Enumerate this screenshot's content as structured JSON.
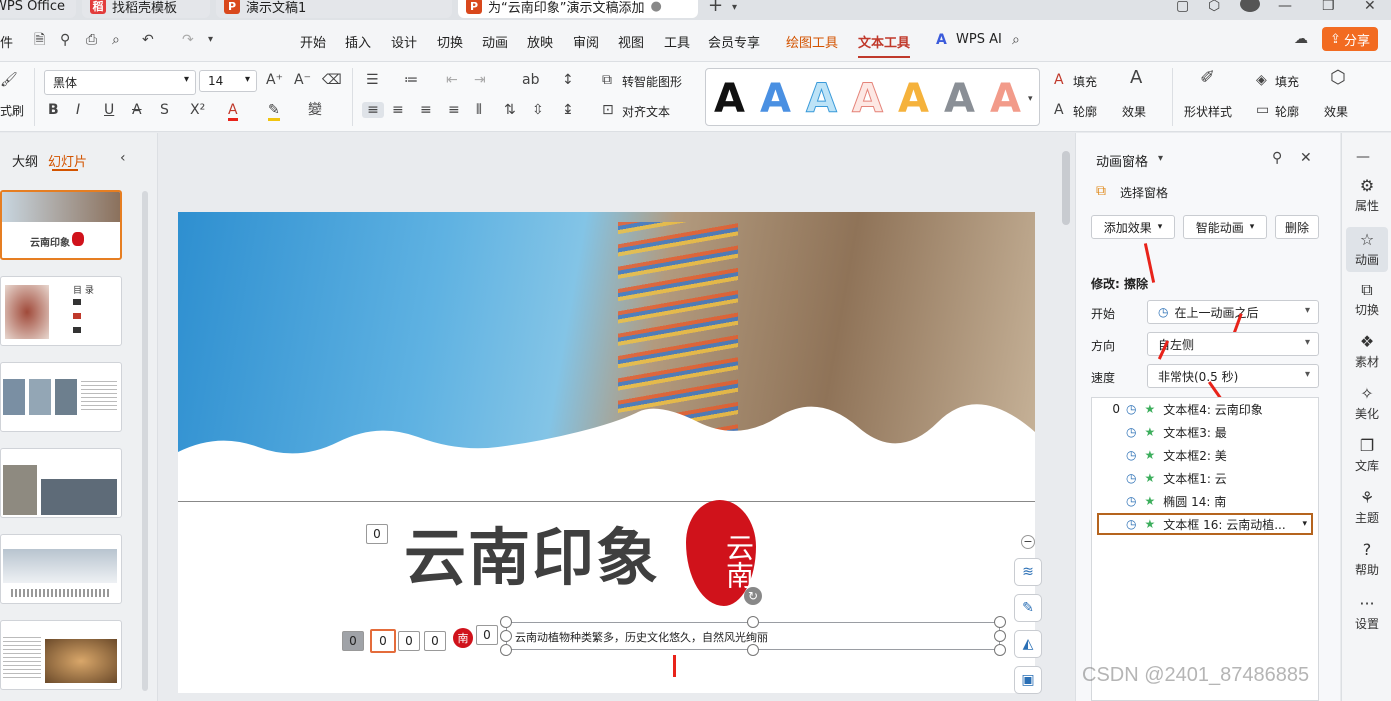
{
  "tabs": [
    {
      "label": "WPS Office",
      "active": false
    },
    {
      "label": "找稻壳模板",
      "active": false
    },
    {
      "label": "演示文稿1",
      "active": false
    },
    {
      "label": "为“云南印象”演示文稿添加",
      "active": true
    }
  ],
  "menu": {
    "file": "件",
    "items": [
      "开始",
      "插入",
      "设计",
      "切换",
      "动画",
      "放映",
      "审阅",
      "视图",
      "工具",
      "会员专享"
    ],
    "drawing_tools": "绘图工具",
    "text_tools": "文本工具",
    "wps_ai": "WPS AI",
    "share": "分享"
  },
  "ribbon": {
    "format_painter": "式刷",
    "font": "黑体",
    "font_size": "14",
    "convert_smartart": "转智能图形",
    "align_text": "对齐文本",
    "fill": "填充",
    "outline": "轮廓",
    "effect": "效果",
    "shape_style": "形状样式",
    "fill2": "填充",
    "outline2": "轮廓",
    "effect2": "效果"
  },
  "left_pane": {
    "outline_tab": "大纲",
    "slides_tab": "幻灯片"
  },
  "slide": {
    "title": "云南印象",
    "seal": "云南",
    "subtitle": "云南动植物种类繁多，历史文化悠久，自然风光绚丽",
    "seal_small": "南",
    "tag": "0"
  },
  "anim_pane": {
    "title": "动画窗格",
    "select_pane": "选择窗格",
    "add_effect": "添加效果",
    "smart_anim": "智能动画",
    "delete": "删除",
    "modify_label": "修改: 擦除",
    "start_label": "开始",
    "start_value": "在上一动画之后",
    "direction_label": "方向",
    "direction_value": "自左侧",
    "speed_label": "速度",
    "speed_value": "非常快(0.5 秒)",
    "items": [
      {
        "index": "0",
        "label": "文本框4: 云南印象"
      },
      {
        "index": "",
        "label": "文本框3: 最"
      },
      {
        "index": "",
        "label": "文本框2: 美"
      },
      {
        "index": "",
        "label": "文本框1: 云"
      },
      {
        "index": "",
        "label": "椭圆 14: 南"
      },
      {
        "index": "",
        "label": "文本框 16: 云南动植..."
      }
    ]
  },
  "right_bar": [
    "属性",
    "动画",
    "切换",
    "素材",
    "美化",
    "文库",
    "主题",
    "帮助",
    "设置"
  ],
  "watermark": "CSDN @2401_87486885",
  "colors": {
    "accent": "#d35400",
    "share": "#f26b21",
    "red": "#e8231a"
  }
}
